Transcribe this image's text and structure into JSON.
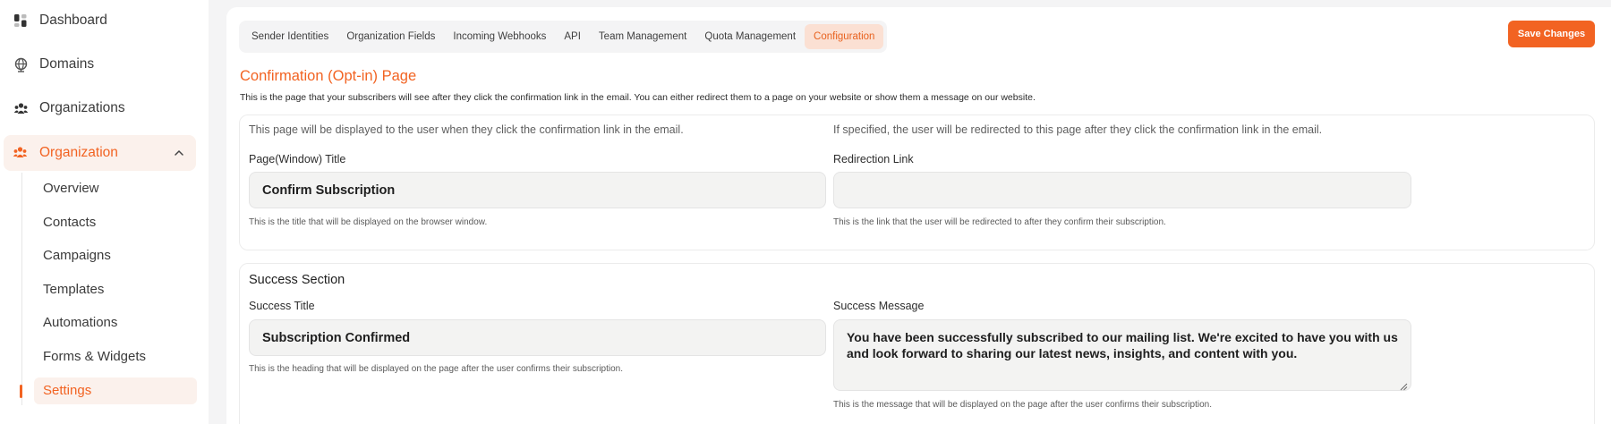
{
  "sidebar": {
    "top_items": [
      {
        "label": "Dashboard",
        "icon": "dashboard-icon"
      },
      {
        "label": "Domains",
        "icon": "globe-icon"
      },
      {
        "label": "Organizations",
        "icon": "users-icon"
      }
    ],
    "active_group": {
      "label": "Organization",
      "icon": "team-icon"
    },
    "sub_items": [
      "Overview",
      "Contacts",
      "Campaigns",
      "Templates",
      "Automations",
      "Forms & Widgets",
      "Settings"
    ],
    "active_sub": "Settings"
  },
  "tabs": [
    "Sender Identities",
    "Organization Fields",
    "Incoming Webhooks",
    "API",
    "Team Management",
    "Quota Management",
    "Configuration"
  ],
  "active_tab": "Configuration",
  "save_label": "Save Changes",
  "page": {
    "title": "Confirmation (Opt-in) Page",
    "description": "This is the page that your subscribers will see after they click the confirmation link in the email. You can either redirect them to a page on your website or show them a message on our website."
  },
  "panel1": {
    "left_hint": "This page will be displayed to the user when they click the confirmation link in the email.",
    "right_hint": "If specified, the user will be redirected to this page after they click the confirmation link in the email.",
    "page_title_label": "Page(Window) Title",
    "page_title_value": "Confirm Subscription",
    "page_title_help": "This is the title that will be displayed on the browser window.",
    "redirect_label": "Redirection Link",
    "redirect_value": "",
    "redirect_help": "This is the link that the user will be redirected to after they confirm their subscription."
  },
  "panel2": {
    "title": "Success Section",
    "success_title_label": "Success Title",
    "success_title_value": "Subscription Confirmed",
    "success_title_help": "This is the heading that will be displayed on the page after the user confirms their subscription.",
    "success_message_label": "Success Message",
    "success_message_value": "You have been successfully subscribed to our mailing list. We're excited to have you with us and look forward to sharing our latest news, insights, and content with you.",
    "success_message_help": "This is the message that will be displayed on the page after the user confirms their subscription."
  },
  "colors": {
    "accent": "#f26322",
    "accent_bg": "#fbf1ec"
  }
}
